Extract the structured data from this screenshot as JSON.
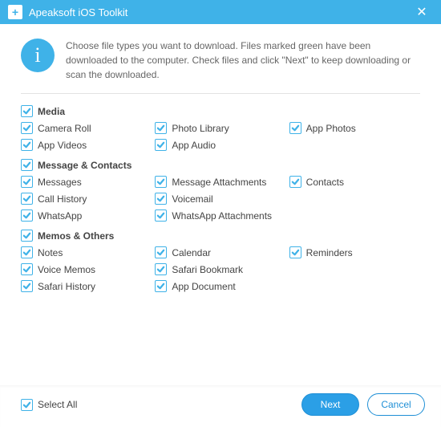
{
  "titlebar": {
    "app_icon_letter": "+",
    "title": "Apeaksoft iOS Toolkit",
    "close_glyph": "✕"
  },
  "info": {
    "icon_glyph": "i",
    "text": "Choose file types you want to download. Files marked green have been downloaded to the computer. Check files and click \"Next\" to keep downloading or scan the downloaded."
  },
  "groups": [
    {
      "header": "Media",
      "items": [
        "Camera Roll",
        "Photo Library",
        "App Photos",
        "App Videos",
        "App Audio"
      ]
    },
    {
      "header": "Message & Contacts",
      "items": [
        "Messages",
        "Message Attachments",
        "Contacts",
        "Call History",
        "Voicemail",
        "",
        "WhatsApp",
        "WhatsApp Attachments"
      ]
    },
    {
      "header": "Memos & Others",
      "items": [
        "Notes",
        "Calendar",
        "Reminders",
        "Voice Memos",
        "Safari Bookmark",
        "",
        "Safari History",
        "App Document"
      ]
    }
  ],
  "footer": {
    "select_all": "Select All",
    "next": "Next",
    "cancel": "Cancel"
  }
}
